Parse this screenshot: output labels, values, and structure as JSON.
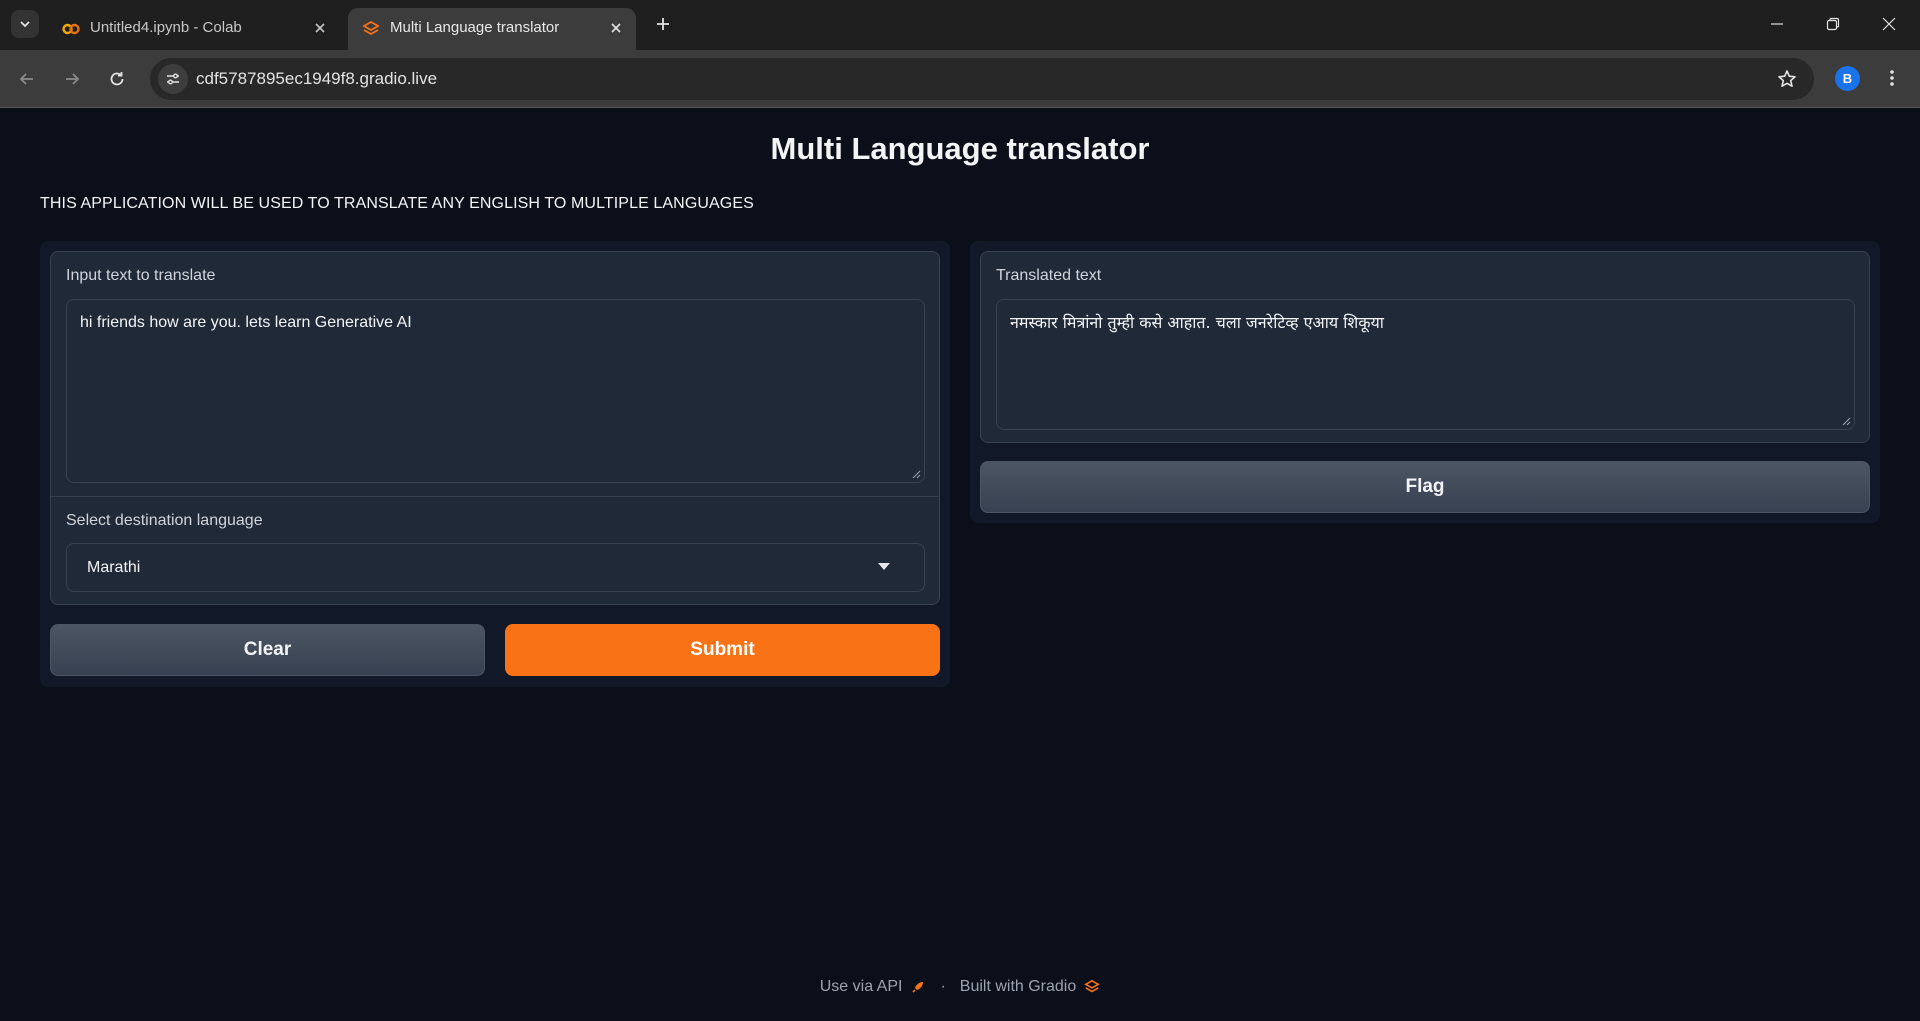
{
  "browser": {
    "tabs": [
      {
        "title": "Untitled4.ipynb - Colab",
        "icon": "colab-icon",
        "active": false
      },
      {
        "title": "Multi Language translator",
        "icon": "gradio-icon",
        "active": true
      }
    ],
    "url": "cdf5787895ec1949f8.gradio.live",
    "profile_initial": "B"
  },
  "app": {
    "title": "Multi Language translator",
    "description": "THIS APPLICATION WILL BE USED TO TRANSLATE ANY ENGLISH TO MULTIPLE LANGUAGES",
    "input": {
      "label": "Input text to translate",
      "value": "hi friends how are you. lets learn Generative AI"
    },
    "language": {
      "label": "Select destination language",
      "selected": "Marathi"
    },
    "buttons": {
      "clear": "Clear",
      "submit": "Submit",
      "flag": "Flag"
    },
    "output": {
      "label": "Translated text",
      "value": "नमस्कार मित्रांनो तुम्ही कसे आहात. चला जनरेटिव्ह एआय शिकूया"
    },
    "footer": {
      "api_link": "Use via API",
      "built_with": "Built with Gradio"
    }
  },
  "colors": {
    "accent": "#f97316",
    "background": "#0b0f19",
    "panel": "#1f2937"
  }
}
